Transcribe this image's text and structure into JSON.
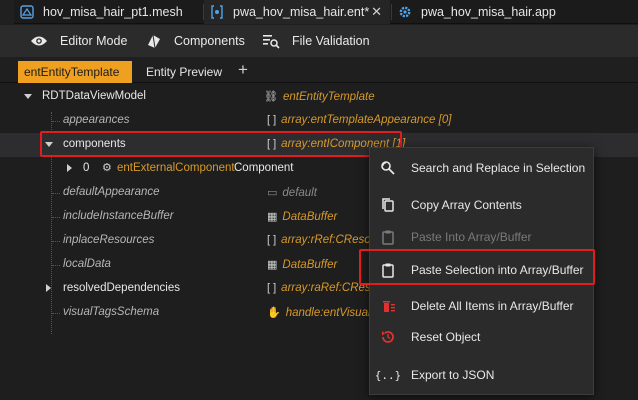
{
  "tabs": [
    {
      "label": "hov_misa_hair_pt1.mesh",
      "icon": "mesh-file-icon",
      "active": false
    },
    {
      "label": "pwa_hov_misa_hair.ent*",
      "icon": "entity-file-icon",
      "active": true
    },
    {
      "label": "pwa_hov_misa_hair.app",
      "icon": "gear-icon",
      "active": false
    }
  ],
  "toolbar": {
    "editor_mode": "Editor Mode",
    "components": "Components",
    "file_validation": "File Validation"
  },
  "subtabs": {
    "active": "entEntityTemplate",
    "preview": "Entity Preview"
  },
  "tree": {
    "root_name": "RDTDataViewModel",
    "root_value": "entEntityTemplate",
    "rows": [
      {
        "name": "appearances",
        "value": "array:entTemplateAppearance [0]"
      },
      {
        "name": "components",
        "value": "array:entIComponent [1]"
      },
      {
        "name": "0",
        "value_type": "entExternalComponent",
        "value_name": "Component"
      },
      {
        "name": "defaultAppearance",
        "value": "default"
      },
      {
        "name": "includeInstanceBuffer",
        "value": "DataBuffer"
      },
      {
        "name": "inplaceResources",
        "value": "array:rRef:CResour"
      },
      {
        "name": "localData",
        "value": "DataBuffer"
      },
      {
        "name": "resolvedDependencies",
        "value": "array:raRef:CResou"
      },
      {
        "name": "visualTagsSchema",
        "value": "handle:entVisualTa"
      }
    ]
  },
  "context_menu": {
    "items": [
      {
        "label": "Search and Replace in Selection",
        "icon": "search-replace-icon",
        "enabled": true
      },
      {
        "label": "Copy Array Contents",
        "icon": "copy-icon",
        "enabled": true
      },
      {
        "label": "Paste Into Array/Buffer",
        "icon": "clipboard-icon",
        "enabled": false
      },
      {
        "label": "Paste Selection into Array/Buffer",
        "icon": "clipboard-icon",
        "enabled": true
      },
      {
        "label": "Delete All Items in Array/Buffer",
        "icon": "delete-icon",
        "enabled": true
      },
      {
        "label": "Reset Object",
        "icon": "reset-icon",
        "enabled": true
      },
      {
        "label": "Export to JSON",
        "icon": "json-icon",
        "enabled": true
      }
    ]
  },
  "colors": {
    "accent": "#f0a020",
    "value_text": "#d79a2a",
    "highlight": "#e11d1d",
    "delete_icon": "#e03030"
  }
}
